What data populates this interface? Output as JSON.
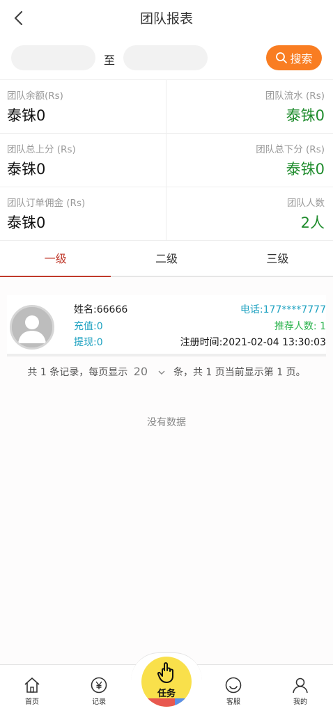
{
  "header": {
    "title": "团队报表"
  },
  "search": {
    "to_label": "至",
    "button_label": "搜索",
    "start_value": "",
    "end_value": ""
  },
  "stats": [
    {
      "left_label": "团队余额(Rs)",
      "left_value": "泰铢0",
      "right_label": "团队流水 (Rs)",
      "right_value": "泰铢0"
    },
    {
      "left_label": "团队总上分 (Rs)",
      "left_value": "泰铢0",
      "right_label": "团队总下分 (Rs)",
      "right_value": "泰铢0"
    },
    {
      "left_label": "团队订单佣金 (Rs)",
      "left_value": "泰铢0",
      "right_label": "团队人数",
      "right_value": "2人"
    }
  ],
  "tabs": [
    "一级",
    "二级",
    "三级"
  ],
  "active_tab": 0,
  "member": {
    "name": "姓名:66666",
    "phone": "电话:177****7777",
    "recharge": "充值:0",
    "referrals": "推荐人数: 1",
    "withdraw": "提现:0",
    "register_time": "注册时间:2021-02-04 13:30:03"
  },
  "pagination": {
    "prefix": "共 1 条记录，每页显示",
    "page_size": "20",
    "suffix": "条，共 1 页当前显示第 1 页。"
  },
  "empty_text": "没有数据",
  "tabbar": {
    "home": "首页",
    "records": "记录",
    "task": "任务",
    "service": "客服",
    "mine": "我的"
  },
  "colors": {
    "accent": "#f97d22",
    "active_tab": "#c0392b",
    "positive": "#1f8c2d",
    "link": "#1fa2c1",
    "task": "#f9e04b"
  }
}
